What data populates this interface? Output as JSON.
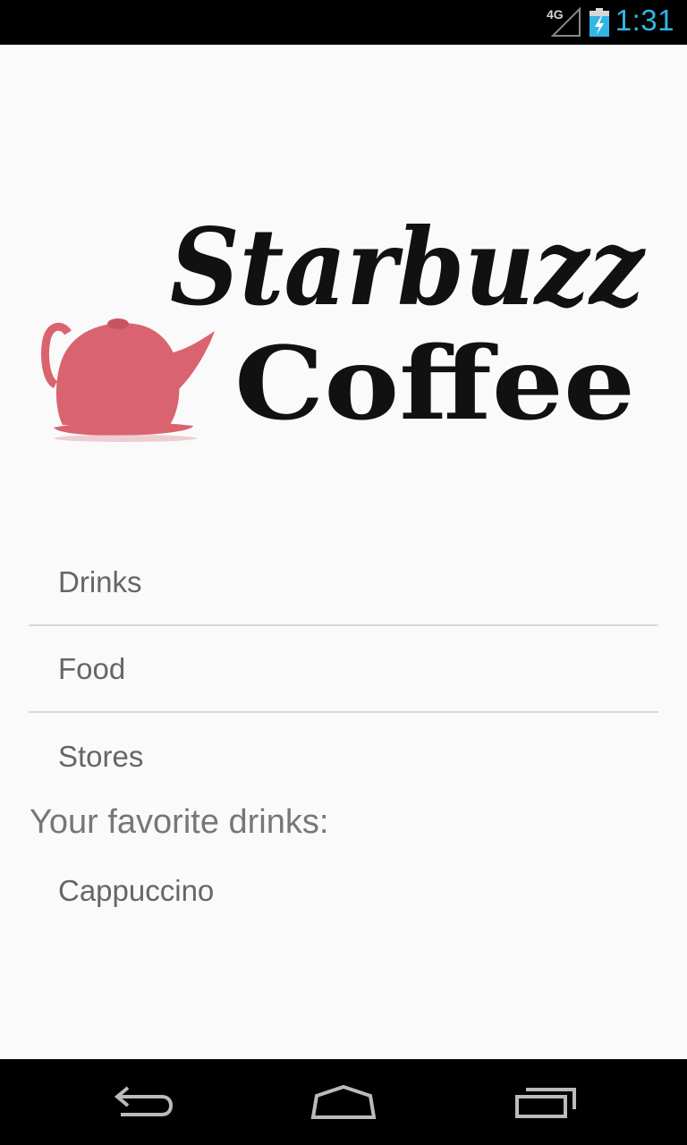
{
  "status_bar": {
    "network_type": "4G",
    "time": "1:31"
  },
  "logo": {
    "line1": "Starbuzz",
    "line2": "Coffee",
    "icon": "teapot-icon"
  },
  "categories": [
    {
      "label": "Drinks"
    },
    {
      "label": "Food"
    },
    {
      "label": "Stores"
    }
  ],
  "favorites": {
    "header": "Your favorite drinks:",
    "items": [
      {
        "label": "Cappuccino"
      }
    ]
  },
  "nav": {
    "back_icon": "back-icon",
    "home_icon": "home-icon",
    "recents_icon": "recent-apps-icon"
  },
  "colors": {
    "accent": "#33b5e5",
    "teapot": "#d9646f",
    "background": "#fafafa"
  }
}
